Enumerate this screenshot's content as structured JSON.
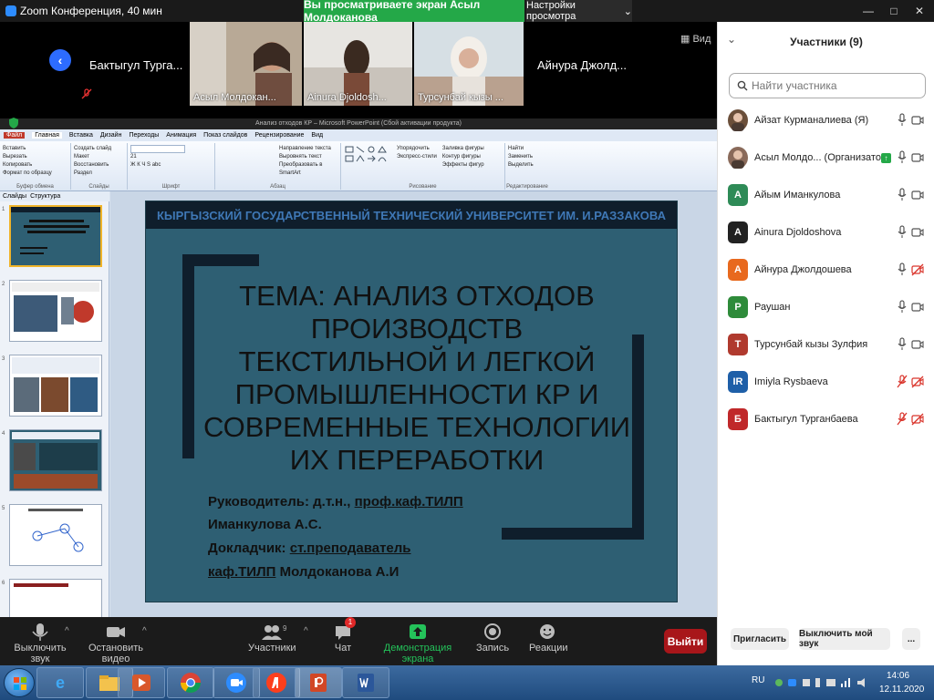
{
  "window": {
    "title": "Zoom Конференция, 40 мин",
    "share_banner": "Вы просматриваете экран Асыл Молдоканова",
    "view_settings": "Настройки просмотра",
    "minimize": "—",
    "maximize": "□",
    "close": "✕"
  },
  "video_strip": {
    "name_tile": "Бактыгул Турга...",
    "tiles": [
      {
        "label": "Асыл Молдокан..."
      },
      {
        "label": "Ainura Djoldosh..."
      },
      {
        "label": "Турсунбай кызы ..."
      }
    ],
    "name_tile_right": "Айнура Джолд...",
    "view_label": "Вид"
  },
  "ppt": {
    "title": "Анализ отходов КР  –  Microsoft PowerPoint (Сбой активации продукта)",
    "file_tab": "Файл",
    "tabs": [
      "Главная",
      "Вставка",
      "Дизайн",
      "Переходы",
      "Анимация",
      "Показ слайдов",
      "Рецензирование",
      "Вид"
    ],
    "groups": {
      "clipboard": {
        "name": "Буфер обмена",
        "items": [
          "Вставить",
          "Вырезать",
          "Копировать",
          "Формат по образцу"
        ]
      },
      "slides": {
        "name": "Слайды",
        "items": [
          "Создать слайд",
          "Макет",
          "Восстановить",
          "Раздел"
        ]
      },
      "font": {
        "name": "Шрифт",
        "items": [
          "Ж  К  Ч  S  abc",
          "21"
        ]
      },
      "paragraph": {
        "name": "Абзац",
        "items": [
          "Направление текста",
          "Выровнять текст",
          "Преобразовать в SmartArt"
        ]
      },
      "drawing": {
        "name": "Рисование",
        "items": [
          "Упорядочить",
          "Экспресс-стили",
          "Заливка фигуры",
          "Контур фигуры",
          "Эффекты фигур"
        ]
      },
      "editing": {
        "name": "Редактирование",
        "items": [
          "Найти",
          "Заменить",
          "Выделить"
        ]
      }
    },
    "pane_tabs": [
      "Слайды",
      "Структура"
    ],
    "thumb_numbers": [
      "1",
      "2",
      "3",
      "4",
      "5",
      "6"
    ]
  },
  "slide": {
    "header": "КЫРГЫЗСКИЙ ГОСУДАРСТВЕННЫЙ ТЕХНИЧЕСКИЙ УНИВЕРСИТЕТ ИМ. И.РАЗЗАКОВА",
    "title": "ТЕМА: АНАЛИЗ ОТХОДОВ ПРОИЗВОДСТВ ТЕКСТИЛЬНОЙ И ЛЕГКОЙ ПРОМЫШЛЕННОСТИ КР И СОВРЕМЕННЫЕ ТЕХНОЛОГИИ ИХ ПЕРЕРАБОТКИ",
    "line1_prefix": "Руководитель: д.т.н., ",
    "line1_link": "проф.каф.ТИЛП",
    "line2": "Иманкулова А.С.",
    "line3_prefix": "Докладчик: ",
    "line3_link": "ст.преподаватель",
    "line4_link": "каф.ТИЛП",
    "line4_suffix": " Молдоканова А.И"
  },
  "controls": {
    "mute": "Выключить звук",
    "video": "Остановить видео",
    "participants": "Участники",
    "participants_count": "9",
    "chat": "Чат",
    "chat_badge": "1",
    "share": "Демонстрация экрана",
    "record": "Запись",
    "reactions": "Реакции",
    "leave": "Выйти"
  },
  "participants_panel": {
    "title": "Участники (9)",
    "search_placeholder": "Найти участника",
    "participants": [
      {
        "initial": "",
        "name": "Айзат Курманалиева (Я)",
        "color": "#6b4f3a",
        "mic": "on",
        "cam": "on"
      },
      {
        "initial": "",
        "name": "Асыл Молдо...  (Организатор)",
        "color": "#8a6a5a",
        "mic": "on",
        "cam": "on",
        "host": true
      },
      {
        "initial": "А",
        "name": "Айым Иманкулова",
        "color": "#2e8b57",
        "mic": "on",
        "cam": "on"
      },
      {
        "initial": "A",
        "name": "Ainura Djoldoshova",
        "color": "#222222",
        "mic": "on",
        "cam": "on"
      },
      {
        "initial": "А",
        "name": "Айнура Джолдошева",
        "color": "#e8691e",
        "mic": "on",
        "cam": "off"
      },
      {
        "initial": "Р",
        "name": "Раушан",
        "color": "#2e8b3a",
        "mic": "on",
        "cam": "on"
      },
      {
        "initial": "Т",
        "name": "Турсунбай кызы Зулфия",
        "color": "#b03a2e",
        "mic": "on",
        "cam": "on"
      },
      {
        "initial": "IR",
        "name": "Imiyla Rysbaeva",
        "color": "#1e5fa8",
        "mic": "off",
        "cam": "off"
      },
      {
        "initial": "Б",
        "name": "Бактыгул Турганбаева",
        "color": "#c0282a",
        "mic": "off",
        "cam": "off"
      }
    ],
    "invite": "Пригласить",
    "mute_me": "Выключить мой звук",
    "more": "..."
  },
  "taskbar": {
    "lang": "RU",
    "time": "14:06",
    "date": "12.11.2020",
    "apps": [
      "ie",
      "explorer",
      "media",
      "chrome",
      "zoom",
      "yandex",
      "powerpoint",
      "word"
    ]
  }
}
